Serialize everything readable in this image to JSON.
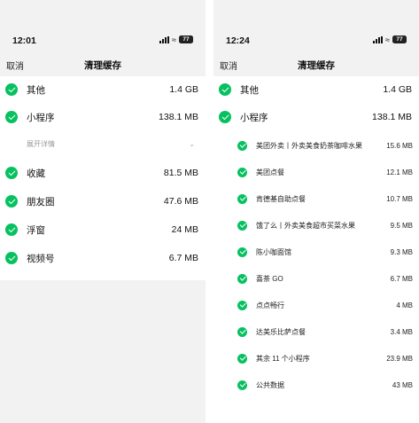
{
  "left": {
    "status": {
      "time": "12:01",
      "battery": "77"
    },
    "nav": {
      "cancel": "取消",
      "title": "清理缓存"
    },
    "rows": [
      {
        "label": "其他",
        "size": "1.4 GB"
      },
      {
        "label": "小程序",
        "size": "138.1 MB"
      }
    ],
    "expand_label": "展开详情",
    "rows_after": [
      {
        "label": "收藏",
        "size": "81.5 MB"
      },
      {
        "label": "朋友圈",
        "size": "47.6 MB"
      },
      {
        "label": "浮窗",
        "size": "24 MB"
      },
      {
        "label": "视频号",
        "size": "6.7 MB"
      }
    ]
  },
  "right": {
    "status": {
      "time": "12:24",
      "battery": "77"
    },
    "nav": {
      "cancel": "取消",
      "title": "清理缓存"
    },
    "rows": [
      {
        "label": "其他",
        "size": "1.4 GB"
      },
      {
        "label": "小程序",
        "size": "138.1 MB"
      }
    ],
    "miniprograms": [
      {
        "label": "美团外卖丨外卖美食奶茶咖啡水果",
        "size": "15.6 MB"
      },
      {
        "label": "美团点餐",
        "size": "12.1 MB"
      },
      {
        "label": "肯德基自助点餐",
        "size": "10.7 MB"
      },
      {
        "label": "饿了么丨外卖美食超市买菜水果",
        "size": "9.5 MB"
      },
      {
        "label": "陈小咖面馆",
        "size": "9.3 MB"
      },
      {
        "label": "喜茶 GO",
        "size": "6.7 MB"
      },
      {
        "label": "点点畅行",
        "size": "4 MB"
      },
      {
        "label": "达美乐比萨点餐",
        "size": "3.4 MB"
      },
      {
        "label": "其余 11 个小程序",
        "size": "23.9 MB"
      },
      {
        "label": "公共数据",
        "size": "43 MB"
      }
    ]
  },
  "colors": {
    "accent": "#07c160",
    "background": "#f2f2f2"
  },
  "icons": {
    "check": "check-circle-icon",
    "chevron": "chevron-down-icon",
    "wifi": "wifi-icon",
    "signal": "signal-icon",
    "battery": "battery-icon"
  }
}
